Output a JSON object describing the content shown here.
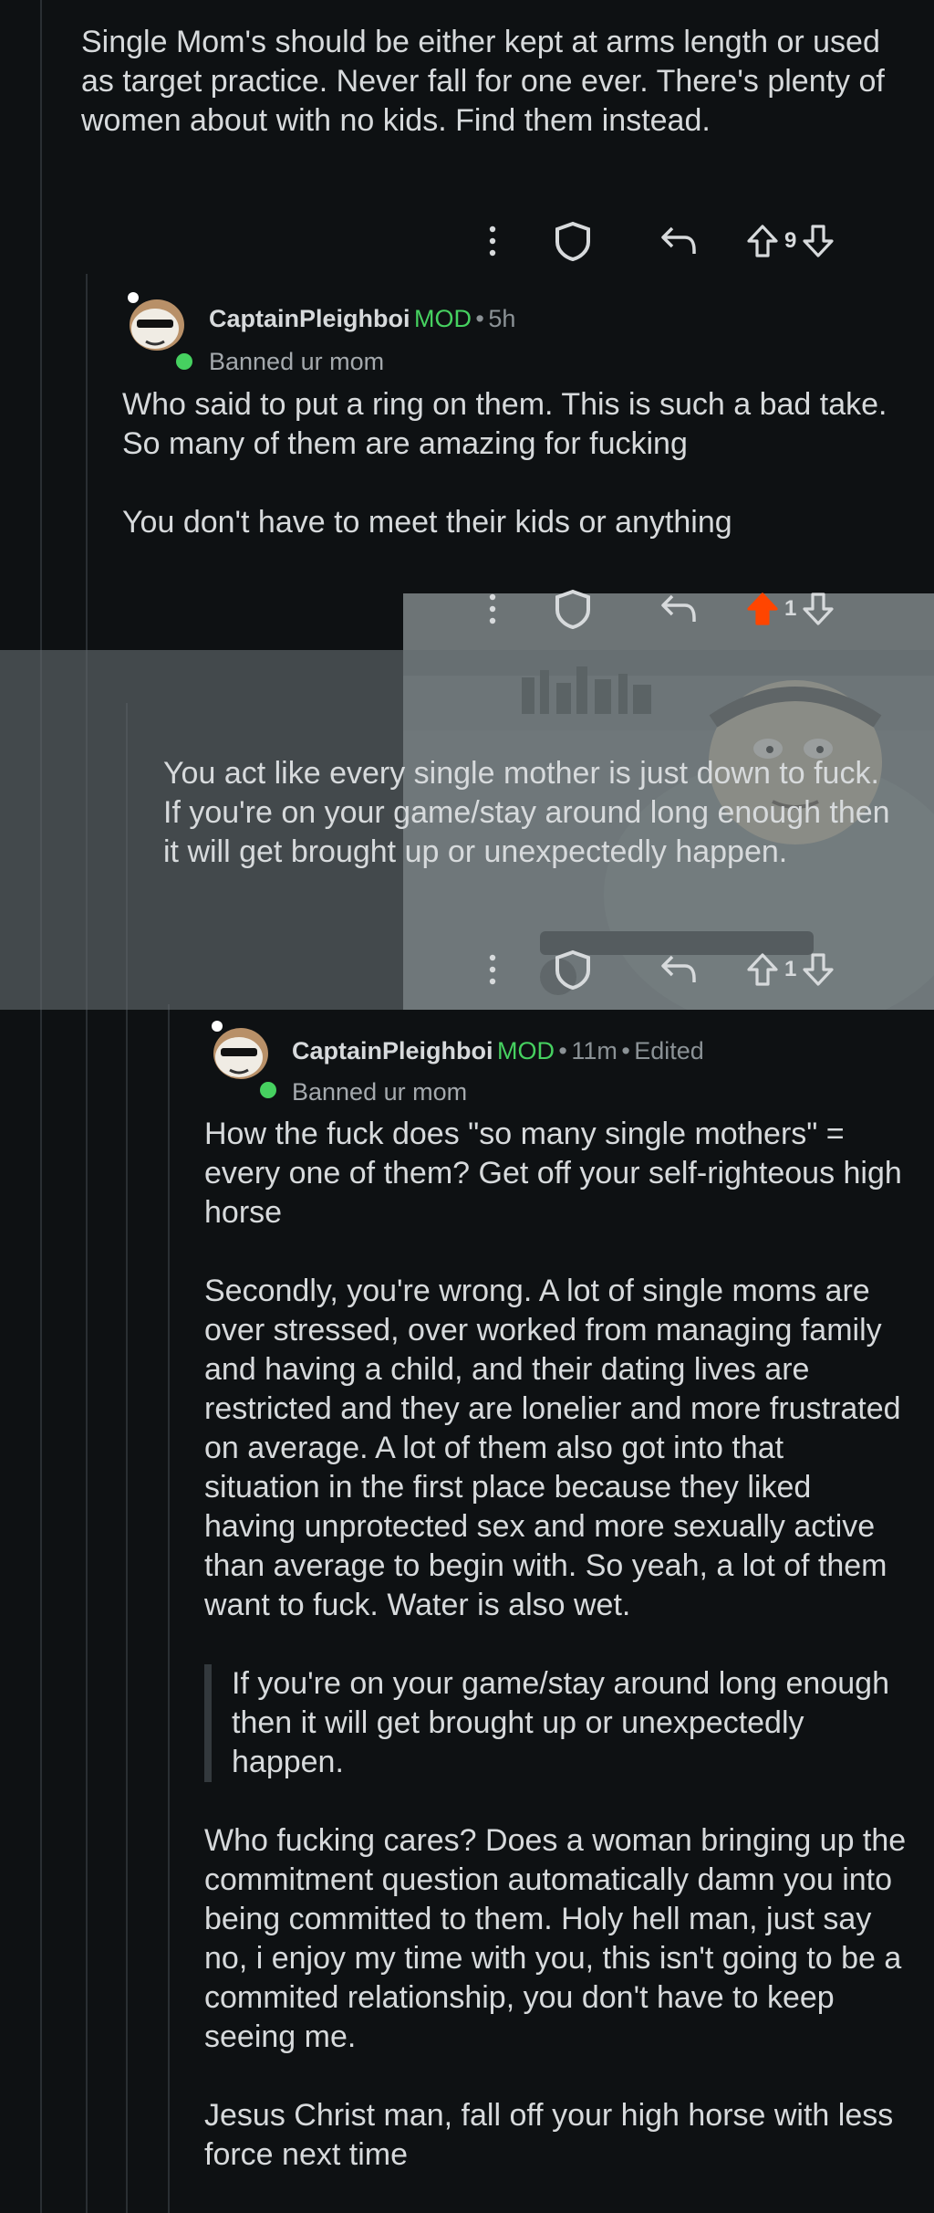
{
  "comments": {
    "top": {
      "paragraphs": [
        "Single Mom's should be either kept at arms length or used as target practice. Never fall for one ever. There's plenty of women about with no kids. Find them instead."
      ],
      "votes": "9"
    },
    "reply1": {
      "author": "CaptainPleighboi",
      "mod_badge": "MOD",
      "separator": "•",
      "time": "5h",
      "flair": "Banned ur mom",
      "paragraphs": [
        "Who said to put a ring on them. This is such a bad take. So many of them are amazing for fucking",
        "You don't have to meet their kids or anything"
      ],
      "votes": "1"
    },
    "reply2": {
      "paragraphs": [
        "You act like every single mother is just down to fuck. If you're on your game/stay around long enough then it will get brought up or unexpectedly happen."
      ],
      "votes": "1"
    },
    "reply3": {
      "author": "CaptainPleighboi",
      "mod_badge": "MOD",
      "separator": "•",
      "time": "11m",
      "separator2": "•",
      "edited": "Edited",
      "flair": "Banned ur mom",
      "paragraph1": "How the fuck does \"so many single mothers\" = every one of them? Get off your self-righteous high horse",
      "paragraph2": "Secondly, you're wrong. A lot of single moms are over stressed, over worked from managing family and having a child, and their dating lives are restricted and they are lonelier and more frustrated on average. A lot of them also got into that situation in the first place because they liked having unprotected sex and more sexually active than average to begin with. So yeah, a lot of them want to fuck. Water is also wet.",
      "quote": "If you're on your game/stay around long enough then it will get brought up or unexpectedly happen.",
      "paragraph3": "Who fucking cares? Does a woman bringing up the commitment question automatically damn you into being committed to them. Holy hell man, just say no, i enjoy my time with you, this isn't going to be a commited relationship, you don't have to keep seeing me.",
      "paragraph4": "Jesus Christ man, fall off your high horse with less force next time"
    }
  },
  "colors": {
    "background": "#0e1113",
    "text": "#d7dadc",
    "mod": "#46d160",
    "upvoted": "#ff4500",
    "meta": "#8b9296"
  },
  "icons": [
    "more-vertical-icon",
    "award-icon",
    "reply-icon",
    "upvote-icon",
    "downvote-icon"
  ]
}
